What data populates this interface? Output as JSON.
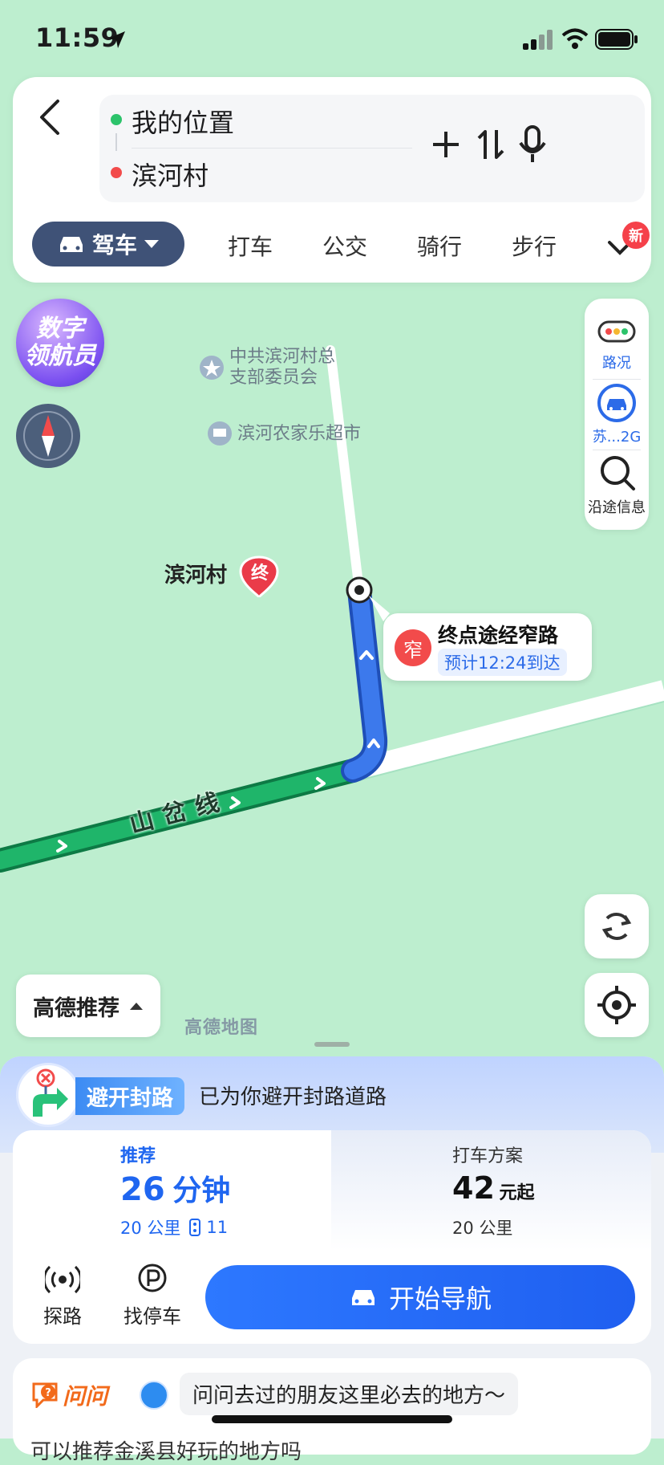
{
  "status_bar": {
    "time": "11:59"
  },
  "search": {
    "origin": "我的位置",
    "destination": "滨河村"
  },
  "modes": {
    "active": "驾车",
    "tabs": [
      "打车",
      "公交",
      "骑行",
      "步行"
    ],
    "new_badge": "新"
  },
  "map": {
    "digital_nav_line1": "数字",
    "digital_nav_line2": "领航员",
    "poi_committee_line1": "中共滨河村总",
    "poi_committee_line2": "支部委员会",
    "poi_market": "滨河农家乐超市",
    "destination_name": "滨河村",
    "end_marker": "终",
    "road_name": "山岔线",
    "watermark": "高德地图",
    "callout_badge": "窄",
    "callout_title": "终点途经窄路",
    "callout_eta": "预计12:24到达"
  },
  "right_panel": {
    "traffic": "路况",
    "plate": "苏...2G",
    "along_info": "沿途信息"
  },
  "route_pref": {
    "label": "高德推荐"
  },
  "sheet": {
    "avoid_tag": "避开封路",
    "avoid_text": "已为你避开封路道路",
    "recommend": {
      "label": "推荐",
      "time_num": "26",
      "time_unit": "分钟",
      "distance": "20 公里",
      "lights": "11"
    },
    "taxi": {
      "label": "打车方案",
      "price": "42",
      "price_unit": "元起",
      "distance": "20 公里"
    },
    "actions": {
      "explore": "探路",
      "parking": "找停车",
      "start_nav": "开始导航"
    },
    "ask": {
      "brand": "问问",
      "prompt": "问问去过的朋友这里必去的地方～",
      "next_line": "可以推荐金溪县好玩的地方吗"
    }
  },
  "colors": {
    "map_bg": "#bdeecf",
    "route_green": "#1fb56a",
    "route_blue": "#3c79ec",
    "accent_blue": "#1f66f0",
    "drive_pill": "#3f5277"
  }
}
